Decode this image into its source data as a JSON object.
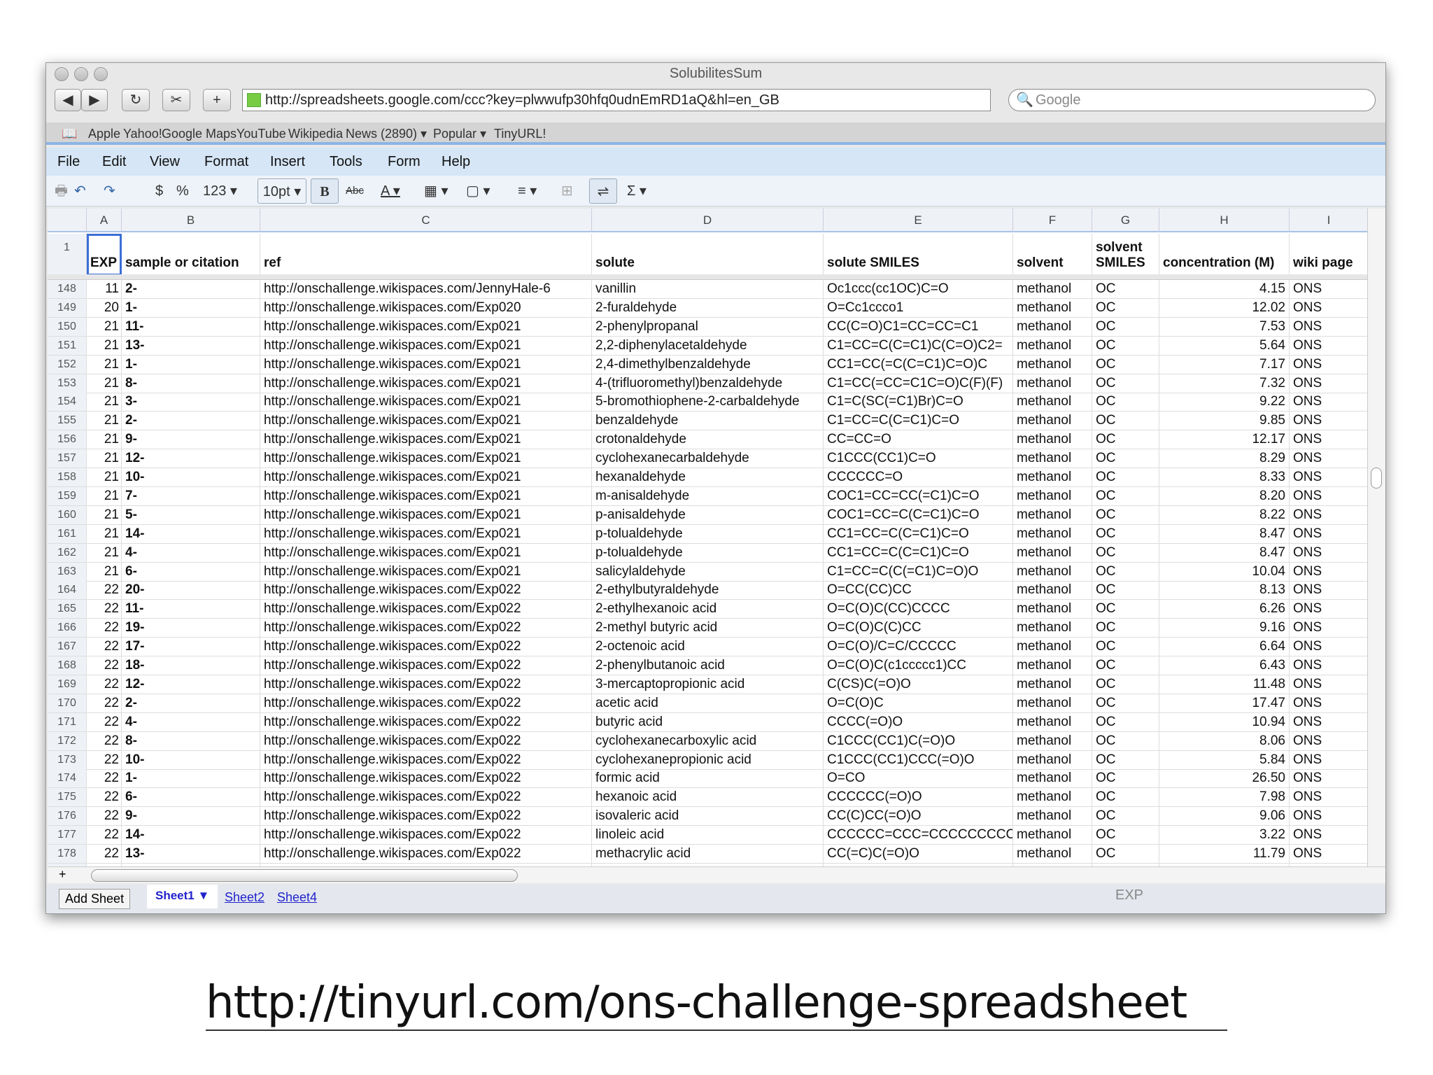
{
  "window": {
    "title": "SolubilitesSum"
  },
  "browser": {
    "url": "http://spreadsheets.google.com/ccc?key=plwwufp30hfq0udnEmRD1aQ&hl=en_GB",
    "search_placeholder": "Google",
    "bookmarks": [
      "Apple",
      "Yahoo!",
      "Google Maps",
      "YouTube",
      "Wikipedia",
      "News (2890) ▾",
      "Popular ▾",
      "TinyURL!"
    ]
  },
  "menu": [
    "File",
    "Edit",
    "View",
    "Format",
    "Insert",
    "Tools",
    "Form",
    "Help"
  ],
  "toolbar": {
    "currency": "$",
    "percent": "%",
    "number_format": "123 ▾",
    "font_size": "10pt ▾",
    "bold": "B",
    "strike": "Abc",
    "text_color": "A ▾",
    "sum": "Σ ▾"
  },
  "columns": [
    "A",
    "B",
    "C",
    "D",
    "E",
    "F",
    "G",
    "H",
    "I"
  ],
  "header_row": {
    "row": "1",
    "cells": [
      "EXP",
      "sample or citation",
      "ref",
      "solute",
      "solute SMILES",
      "solvent",
      "solvent SMILES",
      "concentration (M)",
      "wiki page"
    ]
  },
  "rows": [
    [
      "148",
      "11",
      "2-",
      "http://onschallenge.wikispaces.com/JennyHale-6",
      "vanillin",
      "Oc1ccc(cc1OC)C=O",
      "methanol",
      "OC",
      "4.15",
      "ONS"
    ],
    [
      "149",
      "20",
      "1-",
      "http://onschallenge.wikispaces.com/Exp020",
      "2-furaldehyde",
      "O=Cc1ccco1",
      "methanol",
      "OC",
      "12.02",
      "ONS"
    ],
    [
      "150",
      "21",
      "11-",
      "http://onschallenge.wikispaces.com/Exp021",
      "2-phenylpropanal",
      "CC(C=O)C1=CC=CC=C1",
      "methanol",
      "OC",
      "7.53",
      "ONS"
    ],
    [
      "151",
      "21",
      "13-",
      "http://onschallenge.wikispaces.com/Exp021",
      "2,2-diphenylacetaldehyde",
      "C1=CC=C(C=C1)C(C=O)C2=",
      "methanol",
      "OC",
      "5.64",
      "ONS"
    ],
    [
      "152",
      "21",
      "1-",
      "http://onschallenge.wikispaces.com/Exp021",
      "2,4-dimethylbenzaldehyde",
      "CC1=CC(=C(C=C1)C=O)C",
      "methanol",
      "OC",
      "7.17",
      "ONS"
    ],
    [
      "153",
      "21",
      "8-",
      "http://onschallenge.wikispaces.com/Exp021",
      "4-(trifluoromethyl)benzaldehyde",
      "C1=CC(=CC=C1C=O)C(F)(F)",
      "methanol",
      "OC",
      "7.32",
      "ONS"
    ],
    [
      "154",
      "21",
      "3-",
      "http://onschallenge.wikispaces.com/Exp021",
      "5-bromothiophene-2-carbaldehyde",
      "C1=C(SC(=C1)Br)C=O",
      "methanol",
      "OC",
      "9.22",
      "ONS"
    ],
    [
      "155",
      "21",
      "2-",
      "http://onschallenge.wikispaces.com/Exp021",
      "benzaldehyde",
      "C1=CC=C(C=C1)C=O",
      "methanol",
      "OC",
      "9.85",
      "ONS"
    ],
    [
      "156",
      "21",
      "9-",
      "http://onschallenge.wikispaces.com/Exp021",
      "crotonaldehyde",
      "CC=CC=O",
      "methanol",
      "OC",
      "12.17",
      "ONS"
    ],
    [
      "157",
      "21",
      "12-",
      "http://onschallenge.wikispaces.com/Exp021",
      "cyclohexanecarbaldehyde",
      "C1CCC(CC1)C=O",
      "methanol",
      "OC",
      "8.29",
      "ONS"
    ],
    [
      "158",
      "21",
      "10-",
      "http://onschallenge.wikispaces.com/Exp021",
      "hexanaldehyde",
      "CCCCCC=O",
      "methanol",
      "OC",
      "8.33",
      "ONS"
    ],
    [
      "159",
      "21",
      "7-",
      "http://onschallenge.wikispaces.com/Exp021",
      "m-anisaldehyde",
      "COC1=CC=CC(=C1)C=O",
      "methanol",
      "OC",
      "8.20",
      "ONS"
    ],
    [
      "160",
      "21",
      "5-",
      "http://onschallenge.wikispaces.com/Exp021",
      "p-anisaldehyde",
      "COC1=CC=C(C=C1)C=O",
      "methanol",
      "OC",
      "8.22",
      "ONS"
    ],
    [
      "161",
      "21",
      "14-",
      "http://onschallenge.wikispaces.com/Exp021",
      "p-tolualdehyde",
      "CC1=CC=C(C=C1)C=O",
      "methanol",
      "OC",
      "8.47",
      "ONS"
    ],
    [
      "162",
      "21",
      "4-",
      "http://onschallenge.wikispaces.com/Exp021",
      "p-tolualdehyde",
      "CC1=CC=C(C=C1)C=O",
      "methanol",
      "OC",
      "8.47",
      "ONS"
    ],
    [
      "163",
      "21",
      "6-",
      "http://onschallenge.wikispaces.com/Exp021",
      "salicylaldehyde",
      "C1=CC=C(C(=C1)C=O)O",
      "methanol",
      "OC",
      "10.04",
      "ONS"
    ],
    [
      "164",
      "22",
      "20-",
      "http://onschallenge.wikispaces.com/Exp022",
      "2-ethylbutyraldehyde",
      "O=CC(CC)CC",
      "methanol",
      "OC",
      "8.13",
      "ONS"
    ],
    [
      "165",
      "22",
      "11-",
      "http://onschallenge.wikispaces.com/Exp022",
      "2-ethylhexanoic acid",
      "O=C(O)C(CC)CCCC",
      "methanol",
      "OC",
      "6.26",
      "ONS"
    ],
    [
      "166",
      "22",
      "19-",
      "http://onschallenge.wikispaces.com/Exp022",
      "2-methyl butyric acid",
      "O=C(O)C(C)CC",
      "methanol",
      "OC",
      "9.16",
      "ONS"
    ],
    [
      "167",
      "22",
      "17-",
      "http://onschallenge.wikispaces.com/Exp022",
      "2-octenoic acid",
      "O=C(O)/C=C/CCCCC",
      "methanol",
      "OC",
      "6.64",
      "ONS"
    ],
    [
      "168",
      "22",
      "18-",
      "http://onschallenge.wikispaces.com/Exp022",
      "2-phenylbutanoic acid",
      "O=C(O)C(c1ccccc1)CC",
      "methanol",
      "OC",
      "6.43",
      "ONS"
    ],
    [
      "169",
      "22",
      "12-",
      "http://onschallenge.wikispaces.com/Exp022",
      "3-mercaptopropionic acid",
      "C(CS)C(=O)O",
      "methanol",
      "OC",
      "11.48",
      "ONS"
    ],
    [
      "170",
      "22",
      "2-",
      "http://onschallenge.wikispaces.com/Exp022",
      "acetic acid",
      "O=C(O)C",
      "methanol",
      "OC",
      "17.47",
      "ONS"
    ],
    [
      "171",
      "22",
      "4-",
      "http://onschallenge.wikispaces.com/Exp022",
      "butyric acid",
      "CCCC(=O)O",
      "methanol",
      "OC",
      "10.94",
      "ONS"
    ],
    [
      "172",
      "22",
      "8-",
      "http://onschallenge.wikispaces.com/Exp022",
      "cyclohexanecarboxylic acid",
      "C1CCC(CC1)C(=O)O",
      "methanol",
      "OC",
      "8.06",
      "ONS"
    ],
    [
      "173",
      "22",
      "10-",
      "http://onschallenge.wikispaces.com/Exp022",
      "cyclohexanepropionic acid",
      "C1CCC(CC1)CCC(=O)O",
      "methanol",
      "OC",
      "5.84",
      "ONS"
    ],
    [
      "174",
      "22",
      "1-",
      "http://onschallenge.wikispaces.com/Exp022",
      "formic acid",
      "O=CO",
      "methanol",
      "OC",
      "26.50",
      "ONS"
    ],
    [
      "175",
      "22",
      "6-",
      "http://onschallenge.wikispaces.com/Exp022",
      "hexanoic acid",
      "CCCCCC(=O)O",
      "methanol",
      "OC",
      "7.98",
      "ONS"
    ],
    [
      "176",
      "22",
      "9-",
      "http://onschallenge.wikispaces.com/Exp022",
      "isovaleric acid",
      "CC(C)CC(=O)O",
      "methanol",
      "OC",
      "9.06",
      "ONS"
    ],
    [
      "177",
      "22",
      "14-",
      "http://onschallenge.wikispaces.com/Exp022",
      "linoleic acid",
      "CCCCCC=CCC=CCCCCCCCC",
      "methanol",
      "OC",
      "3.22",
      "ONS"
    ],
    [
      "178",
      "22",
      "13-",
      "http://onschallenge.wikispaces.com/Exp022",
      "methacrylic acid",
      "CC(=C)C(=O)O",
      "methanol",
      "OC",
      "11.79",
      "ONS"
    ]
  ],
  "sheets": {
    "add": "Add Sheet",
    "active": "Sheet1 ▼",
    "others": [
      "Sheet2",
      "Sheet4"
    ],
    "cell_ref": "EXP"
  },
  "footer_link": "http://tinyurl.com/ons-challenge-spreadsheet"
}
